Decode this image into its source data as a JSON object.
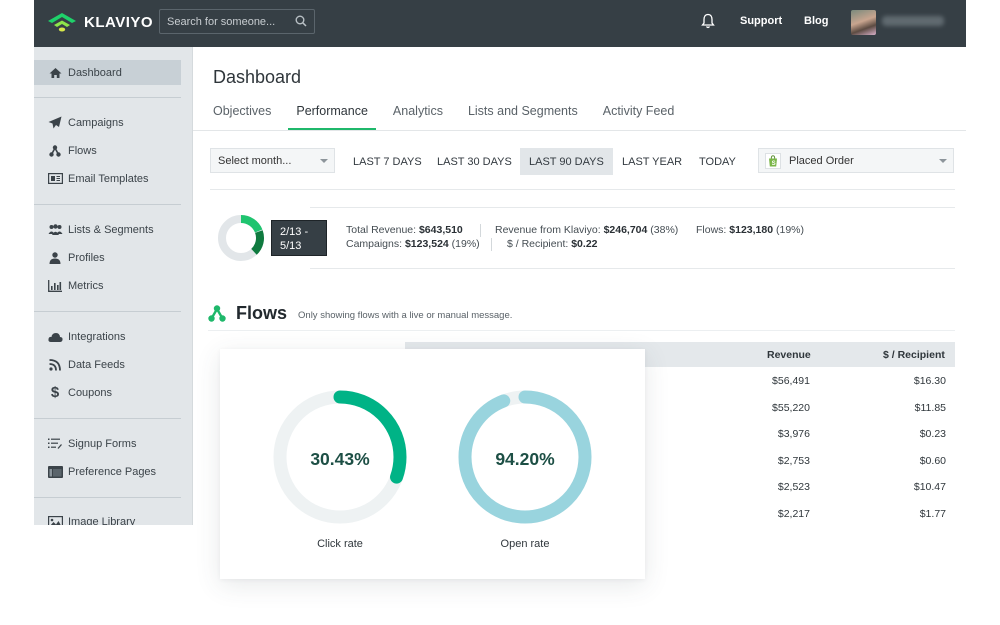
{
  "topbar": {
    "brand": "KLAVIYO",
    "search_placeholder": "Search for someone...",
    "links": [
      "Support",
      "Blog"
    ],
    "icons": {
      "notifications": "bell-icon",
      "search": "search-icon"
    },
    "brand_color": "#1fb86b"
  },
  "sidebar": {
    "items": [
      {
        "label": "Dashboard",
        "icon": "home-icon",
        "active": true
      },
      {
        "label": "Campaigns",
        "icon": "paper-plane-icon"
      },
      {
        "label": "Flows",
        "icon": "flows-icon"
      },
      {
        "label": "Email Templates",
        "icon": "template-icon"
      },
      {
        "label": "Lists & Segments",
        "icon": "users-icon"
      },
      {
        "label": "Profiles",
        "icon": "user-icon"
      },
      {
        "label": "Metrics",
        "icon": "bar-chart-icon"
      },
      {
        "label": "Integrations",
        "icon": "cloud-icon"
      },
      {
        "label": "Data Feeds",
        "icon": "rss-icon"
      },
      {
        "label": "Coupons",
        "icon": "dollar-icon"
      },
      {
        "label": "Signup Forms",
        "icon": "form-list-icon"
      },
      {
        "label": "Preference Pages",
        "icon": "window-icon"
      },
      {
        "label": "Image Library",
        "icon": "image-icon"
      }
    ]
  },
  "main": {
    "title": "Dashboard",
    "tabs": [
      {
        "label": "Objectives"
      },
      {
        "label": "Performance",
        "active": true
      },
      {
        "label": "Analytics"
      },
      {
        "label": "Lists and Segments"
      },
      {
        "label": "Activity Feed"
      }
    ],
    "filters": {
      "month_select": "Select month...",
      "ranges": [
        "LAST 7 DAYS",
        "LAST 30 DAYS",
        "LAST 90 DAYS",
        "LAST YEAR",
        "TODAY"
      ],
      "active_range": "LAST 90 DAYS",
      "metric_select": "Placed Order"
    },
    "summary": {
      "date_range_line1": "2/13 -",
      "date_range_line2": "5/13",
      "total_revenue_label": "Total Revenue:",
      "total_revenue": "$643,510",
      "campaigns_label": "Campaigns:",
      "campaigns_value": "$123,524",
      "campaigns_pct": "(19%)",
      "klaviyo_label": "Revenue from Klaviyo:",
      "klaviyo_value": "$246,704",
      "klaviyo_pct": "(38%)",
      "per_recipient_label": "$ / Recipient:",
      "per_recipient_value": "$0.22",
      "flows_label": "Flows:",
      "flows_value": "$123,180",
      "flows_pct": "(19%)",
      "donut": {
        "klaviyo_fraction": 0.38,
        "campaigns_fraction": 0.19,
        "flows_fraction": 0.19
      }
    },
    "flows": {
      "title": "Flows",
      "subtitle": "Only showing flows with a live or manual message.",
      "columns": [
        "Revenue",
        "$ / Recipient"
      ],
      "rows": [
        {
          "revenue": "$56,491",
          "per_recipient": "$16.30"
        },
        {
          "revenue": "$55,220",
          "per_recipient": "$11.85"
        },
        {
          "revenue": "$3,976",
          "per_recipient": "$0.23"
        },
        {
          "revenue": "$2,753",
          "per_recipient": "$0.60"
        },
        {
          "revenue": "$2,523",
          "per_recipient": "$10.47"
        },
        {
          "revenue": "$2,217",
          "per_recipient": "$1.77"
        }
      ]
    }
  },
  "rates_card": {
    "click_rate": {
      "label": "Click rate",
      "value_text": "30.43%",
      "value": 0.3043,
      "color": "#00b386"
    },
    "open_rate": {
      "label": "Open rate",
      "value_text": "94.20%",
      "value": 0.942,
      "color": "#99d4de"
    }
  }
}
